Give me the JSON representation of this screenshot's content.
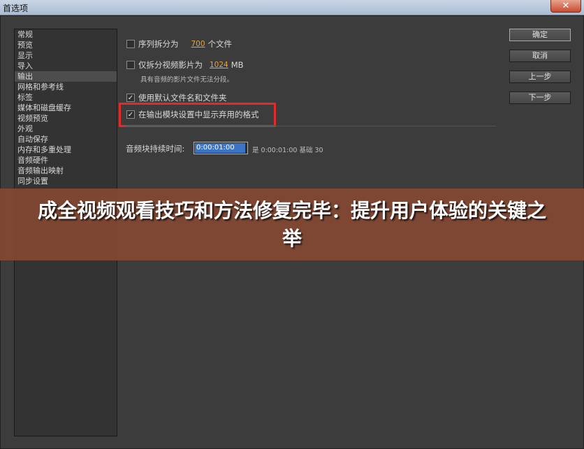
{
  "window": {
    "title": "首选项",
    "close_glyph": "✕"
  },
  "sidebar": {
    "items": [
      {
        "label": "常规"
      },
      {
        "label": "预览"
      },
      {
        "label": "显示"
      },
      {
        "label": "导入"
      },
      {
        "label": "输出",
        "selected": true
      },
      {
        "label": "网格和参考线"
      },
      {
        "label": "标签"
      },
      {
        "label": "媒体和磁盘缓存"
      },
      {
        "label": "视频预览"
      },
      {
        "label": "外观"
      },
      {
        "label": "自动保存"
      },
      {
        "label": "内存和多重处理"
      },
      {
        "label": "音频硬件"
      },
      {
        "label": "音频输出映射"
      },
      {
        "label": "同步设置"
      }
    ]
  },
  "output": {
    "split_sequence": {
      "checked": false,
      "label": "序列拆分为",
      "value": "700",
      "unit": "个文件"
    },
    "split_video_only": {
      "checked": false,
      "label": "仅拆分视频影片为",
      "value": "1024",
      "unit": "MB"
    },
    "split_note": "具有音频的影片文件无法分段。",
    "use_default_names": {
      "checked": true,
      "label": "使用默认文件名和文件夹"
    },
    "show_deprecated_formats": {
      "checked": true,
      "label": "在输出模块设置中显示弃用的格式"
    },
    "audio_duration_label": "音频块持续时间:",
    "audio_duration_value": "0:00:01:00",
    "audio_duration_info": "是 0:00:01:00  基础 30",
    "check_glyph": "✓"
  },
  "buttons": {
    "ok": "确定",
    "cancel": "取消",
    "prev": "上一步",
    "next": "下一步"
  },
  "banner": {
    "text": "成全视频观看技巧和方法修复完毕：提升用户体验的关键之举"
  },
  "colors": {
    "highlight": "#e12a2a",
    "value_accent": "#e8a43a",
    "banner_bg": "#834834"
  }
}
